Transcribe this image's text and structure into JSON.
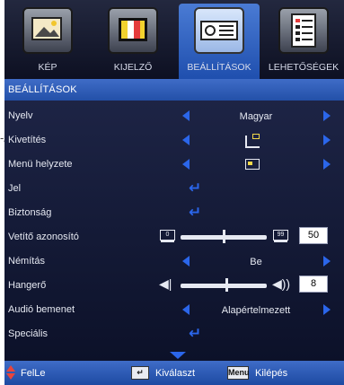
{
  "tabs": [
    {
      "label": "KÉP",
      "icon": "picture-icon",
      "active": false
    },
    {
      "label": "KIJELZŐ",
      "icon": "color-bars-icon",
      "active": false
    },
    {
      "label": "BEÁLLÍTÁSOK",
      "icon": "projector-icon",
      "active": true
    },
    {
      "label": "LEHETŐSÉGEK",
      "icon": "checklist-icon",
      "active": false
    }
  ],
  "section_title": "BEÁLLÍTÁSOK",
  "rows": {
    "language": {
      "label": "Nyelv",
      "value": "Magyar"
    },
    "projection": {
      "label": "Kivetítés"
    },
    "menu_position": {
      "label": "Menü helyzete"
    },
    "signal": {
      "label": "Jel"
    },
    "security": {
      "label": "Biztonság"
    },
    "projector_id": {
      "label": "Vetítő azonosító",
      "min_chip": "0",
      "max_chip": "99",
      "value": "50",
      "level_percent": 50
    },
    "mute": {
      "label": "Némítás",
      "value": "Be"
    },
    "volume": {
      "label": "Hangerő",
      "value": "8",
      "level_percent": 53
    },
    "audio_input": {
      "label": "Audió bemenet",
      "value": "Alapértelmezett"
    },
    "advanced": {
      "label": "Speciális"
    }
  },
  "footer": {
    "updown_label": "FelLe",
    "select_label": "Kiválaszt",
    "menu_key": "Menu",
    "exit_label": "Kilépés"
  },
  "side_mark": "-/",
  "colors": {
    "accent": "#2b66ea",
    "active_tab": "#2f5fbf",
    "background": "#0f1530",
    "nav_arrow": "#e8453c"
  }
}
